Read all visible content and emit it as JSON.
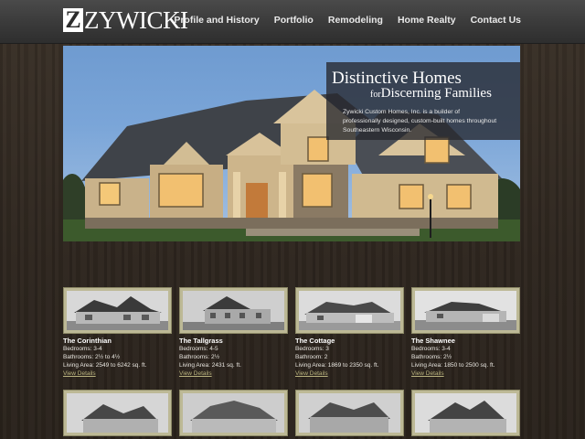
{
  "header": {
    "logo_mark": "Z",
    "logo_text": "ZYWICKI",
    "nav": [
      {
        "label": "Profile and History"
      },
      {
        "label": "Portfolio"
      },
      {
        "label": "Remodeling"
      },
      {
        "label": "Home Realty"
      },
      {
        "label": "Contact Us"
      }
    ]
  },
  "hero": {
    "title_line1": "Distinctive Homes",
    "title_for": "for",
    "title_line2": "Discerning Families",
    "description": "Zywicki Custom Homes, Inc. is a builder of professionally designed, custom-built homes throughout Southeastern Wisconsin."
  },
  "homes": [
    {
      "name": "The Corinthian",
      "bedrooms": "Bedrooms: 3-4",
      "bathrooms": "Bathrooms: 2½ to 4½",
      "area": "Living Area: 2549 to 6242 sq. ft.",
      "link": "View Details"
    },
    {
      "name": "The Tallgrass",
      "bedrooms": "Bedrooms: 4-5",
      "bathrooms": "Bathrooms: 2½",
      "area": "Living Area: 2431 sq. ft.",
      "link": "View Details"
    },
    {
      "name": "The Cottage",
      "bedrooms": "Bedrooms: 3",
      "bathrooms": "Bathroom: 2",
      "area": "Living Area: 1869 to 2350 sq. ft.",
      "link": "View Details"
    },
    {
      "name": "The Shawnee",
      "bedrooms": "Bedrooms: 3-4",
      "bathrooms": "Bathrooms: 2½",
      "area": "Living Area: 1850 to 2500 sq. ft.",
      "link": "View Details"
    }
  ],
  "colors": {
    "header_bg": "#3a3a3a",
    "wood_bg": "#2e261f",
    "thumb_frame": "#bdb996",
    "link": "#b9b37e"
  }
}
